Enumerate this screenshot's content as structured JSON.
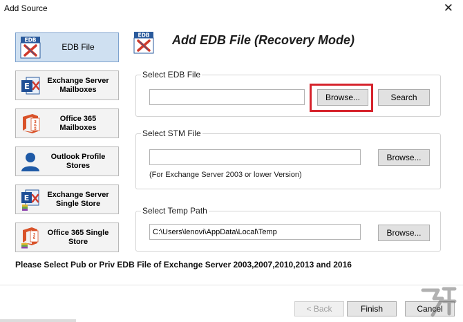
{
  "window": {
    "title": "Add Source",
    "close_glyph": "✕"
  },
  "sources": [
    {
      "id": "edb",
      "label": "EDB File",
      "icon": "edb-file-icon",
      "active": true
    },
    {
      "id": "exchange",
      "label": "Exchange Server Mailboxes",
      "icon": "exchange-server-icon",
      "active": false
    },
    {
      "id": "o365",
      "label": "Office 365 Mailboxes",
      "icon": "office365-icon",
      "active": false
    },
    {
      "id": "outlook",
      "label": "Outlook Profile Stores",
      "icon": "outlook-profile-icon",
      "active": false
    },
    {
      "id": "exchange-single",
      "label": "Exchange Server Single Store",
      "icon": "exchange-single-store-icon",
      "active": false
    },
    {
      "id": "o365-single",
      "label": "Office 365 Single Store",
      "icon": "office365-single-store-icon",
      "active": false
    }
  ],
  "heading": {
    "icon_text": "EDB",
    "text": "Add EDB File (Recovery Mode)"
  },
  "edb_group": {
    "title": "Select EDB File",
    "value": "",
    "browse_label": "Browse...",
    "search_label": "Search"
  },
  "stm_group": {
    "title": "Select STM File",
    "value": "",
    "browse_label": "Browse...",
    "note": "(For Exchange Server 2003 or lower Version)"
  },
  "temp_group": {
    "title": "Select Temp Path",
    "value": "C:\\Users\\lenovi\\AppData\\Local\\Temp",
    "browse_label": "Browse..."
  },
  "footer": {
    "message": "Please Select Pub or Priv EDB File of Exchange Server 2003,2007,2010,2013 and 2016",
    "back_label": "< Back",
    "finish_label": "Finish",
    "cancel_label": "Cancel"
  },
  "colors": {
    "highlight": "#d6232c",
    "active_bg": "#cfe0f1",
    "active_border": "#7da2ce",
    "edb_blue": "#2a5a9c",
    "edb_red": "#d03a2c",
    "office_orange": "#d9532a"
  }
}
